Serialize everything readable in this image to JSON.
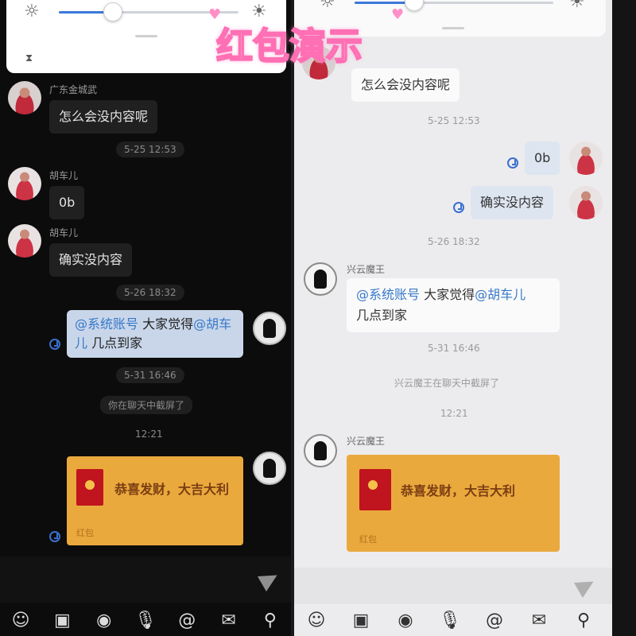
{
  "overlay_title": "红包演示",
  "left": {
    "messages": {
      "sender1_name": "广东金城武",
      "sender1_text": "怎么会没内容呢",
      "time1": "5-25 12:53",
      "sender2_name": "胡车儿",
      "sender2_text1": "0b",
      "sender3_name": "胡车儿",
      "sender3_text": "确实没内容",
      "time2": "5-26 18:32",
      "self_mention1": "@系统账号",
      "self_mid": " 大家觉得",
      "self_mention2": "@胡车",
      "self_line2_mention": "儿",
      "self_line2_rest": " 几点到家",
      "time3": "5-31 16:46",
      "system_note": "你在聊天中截屏了",
      "time4": "12:21",
      "envelope_text": "恭喜发财，大吉大利",
      "envelope_foot": "红包"
    },
    "toolbar": [
      "☺",
      "▣",
      "◉",
      "🎙",
      "@",
      "✉",
      "⚲"
    ]
  },
  "right": {
    "messages": {
      "top_text": "怎么会没内容呢",
      "time1": "5-25 12:53",
      "self_text1": "0b",
      "self_text2": "确实没内容",
      "time2": "5-26 18:32",
      "sender_name": "兴云魔王",
      "mention1": "@系统账号",
      "mid": " 大家觉得",
      "mention2": "@胡车儿",
      "line2": "几点到家",
      "time3": "5-31 16:46",
      "system_note": "兴云魔王在聊天中截屏了",
      "time4": "12:21",
      "sender_name2": "兴云魔王",
      "envelope_text": "恭喜发财，大吉大利",
      "envelope_foot": "红包"
    },
    "toolbar": [
      "☺",
      "▣",
      "◉",
      "🎙",
      "@",
      "✉",
      "⚲"
    ]
  },
  "brightness": {
    "left_level": 0.3,
    "right_level": 0.3,
    "icons": [
      "sun-icon-dim",
      "sun-icon-bright",
      "hourglass-icon"
    ]
  },
  "colors": {
    "left_bg": "#0c0c0c",
    "right_bg": "#ececee",
    "accent": "#3778c8",
    "envelope": "#eaa93d",
    "title_stroke": "#ff6fb4"
  }
}
